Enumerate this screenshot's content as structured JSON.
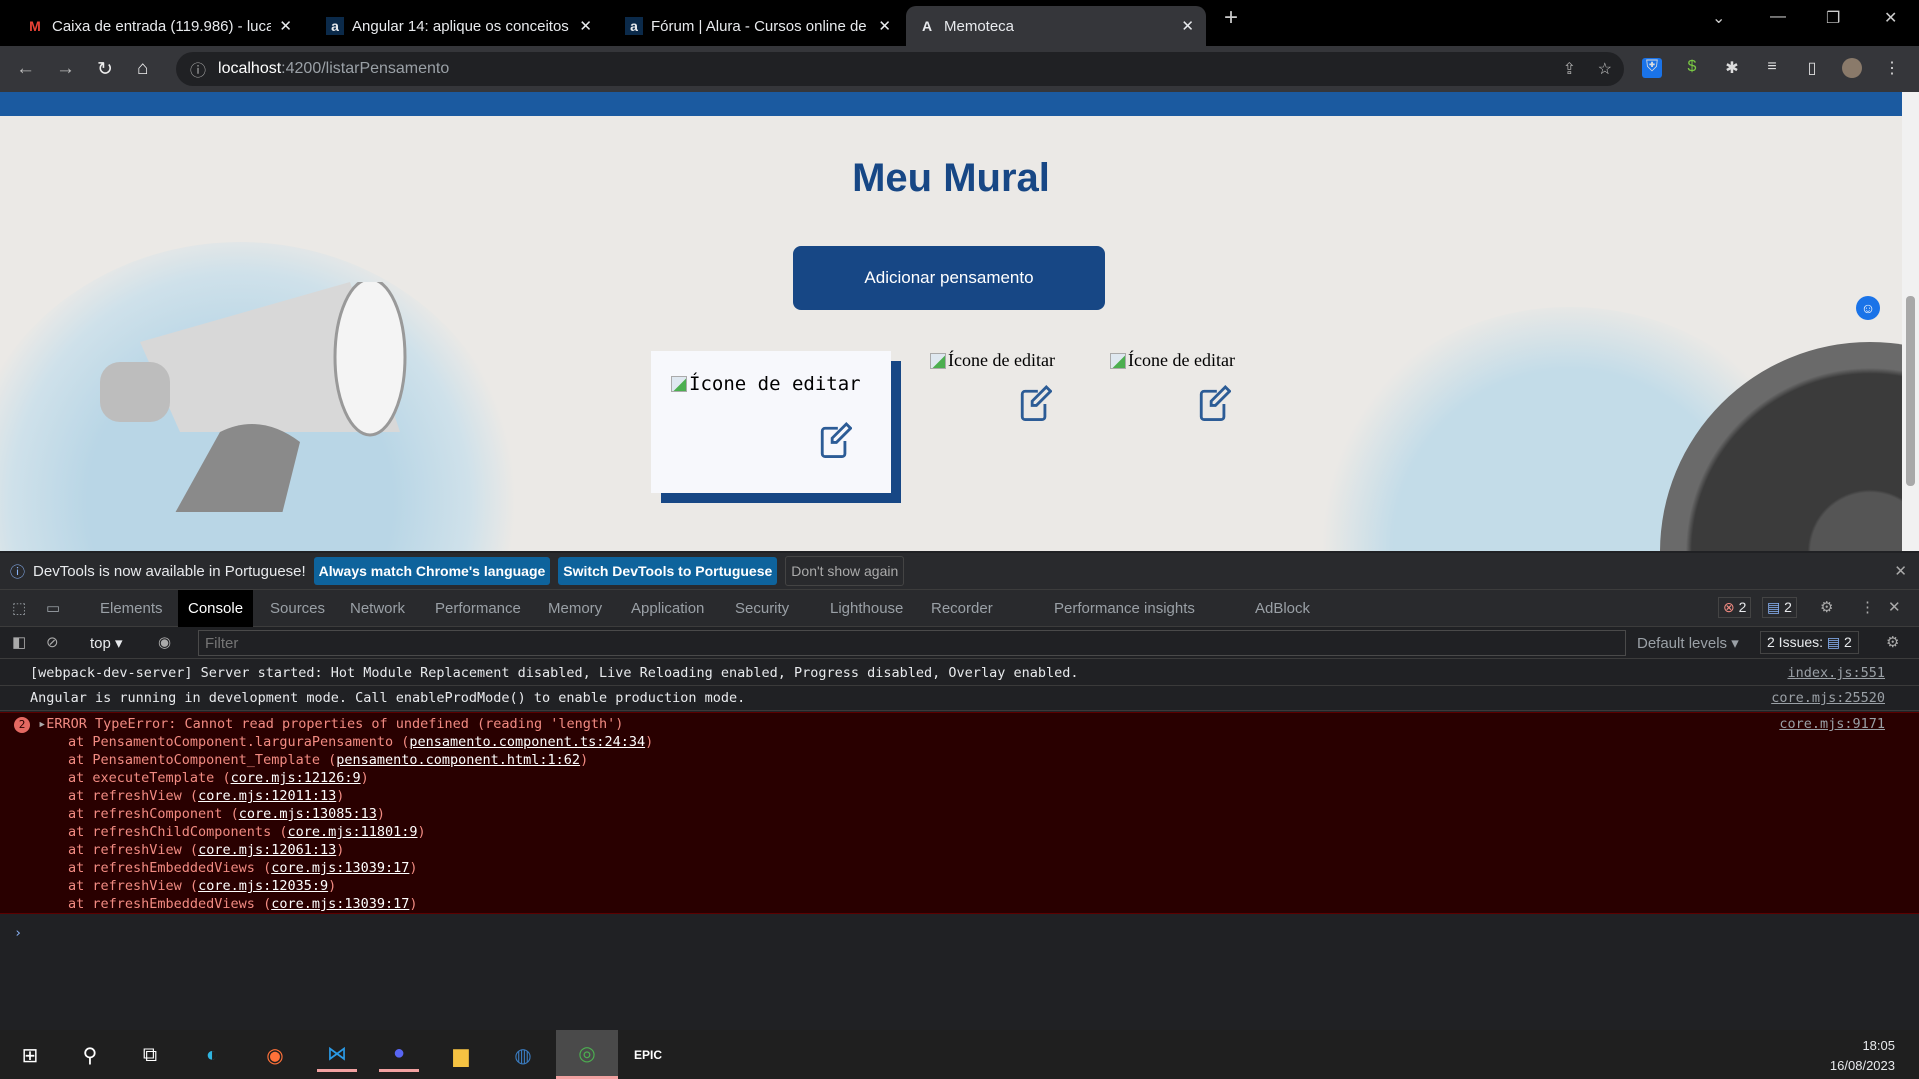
{
  "browser": {
    "tabs": [
      {
        "title": "Caixa de entrada (119.986) - luca",
        "icon": "gmail-icon"
      },
      {
        "title": "Angular 14: aplique os conceitos",
        "icon": "alura-icon"
      },
      {
        "title": "Fórum | Alura - Cursos online de",
        "icon": "alura-icon"
      },
      {
        "title": "Memoteca",
        "icon": "angular-icon",
        "active": true
      }
    ],
    "url_host": "localhost",
    "url_path": ":4200/listarPensamento"
  },
  "page": {
    "title": "Meu Mural",
    "add_button": "Adicionar pensamento",
    "cards": [
      {
        "alt": "Ícone de editar"
      },
      {
        "alt": "Ícone de editar"
      },
      {
        "alt": "Ícone de editar"
      }
    ],
    "accent": "#174785"
  },
  "devtools": {
    "notice": {
      "text": "DevTools is now available in Portuguese!",
      "btn1": "Always match Chrome's language",
      "btn2": "Switch DevTools to Portuguese",
      "btn3": "Don't show again"
    },
    "tabs": [
      "Elements",
      "Console",
      "Sources",
      "Network",
      "Performance",
      "Memory",
      "Application",
      "Security",
      "Lighthouse",
      "Recorder",
      "Performance insights",
      "AdBlock"
    ],
    "active_tab": "Console",
    "error_count": "2",
    "message_count": "2",
    "context": "top",
    "filter_placeholder": "Filter",
    "levels": "Default levels",
    "issues": "2 Issues:",
    "issues_count": "2",
    "logs": [
      {
        "text": "[webpack-dev-server] Server started: Hot Module Replacement disabled, Live Reloading enabled, Progress disabled, Overlay enabled.",
        "source": "index.js:551"
      },
      {
        "text": "Angular is running in development mode. Call enableProdMode() to enable production mode.",
        "source": "core.mjs:25520"
      }
    ],
    "error": {
      "count": "2",
      "message": "ERROR TypeError: Cannot read properties of undefined (reading 'length')",
      "source": "core.mjs:9171",
      "stack": [
        {
          "fn": "at PensamentoComponent.larguraPensamento",
          "loc": "pensamento.component.ts:24:34"
        },
        {
          "fn": "at PensamentoComponent_Template",
          "loc": "pensamento.component.html:1:62"
        },
        {
          "fn": "at executeTemplate",
          "loc": "core.mjs:12126:9"
        },
        {
          "fn": "at refreshView",
          "loc": "core.mjs:12011:13"
        },
        {
          "fn": "at refreshComponent",
          "loc": "core.mjs:13085:13"
        },
        {
          "fn": "at refreshChildComponents",
          "loc": "core.mjs:11801:9"
        },
        {
          "fn": "at refreshView",
          "loc": "core.mjs:12061:13"
        },
        {
          "fn": "at refreshEmbeddedViews",
          "loc": "core.mjs:13039:17"
        },
        {
          "fn": "at refreshView",
          "loc": "core.mjs:12035:9"
        },
        {
          "fn": "at refreshEmbeddedViews",
          "loc": "core.mjs:13039:17"
        }
      ]
    }
  },
  "taskbar": {
    "time": "18:05",
    "date": "16/08/2023",
    "apps": [
      "start",
      "search",
      "task-view",
      "edge",
      "firefox",
      "vscode",
      "discord",
      "file-explorer",
      "steam",
      "chrome",
      "epic-games"
    ]
  }
}
